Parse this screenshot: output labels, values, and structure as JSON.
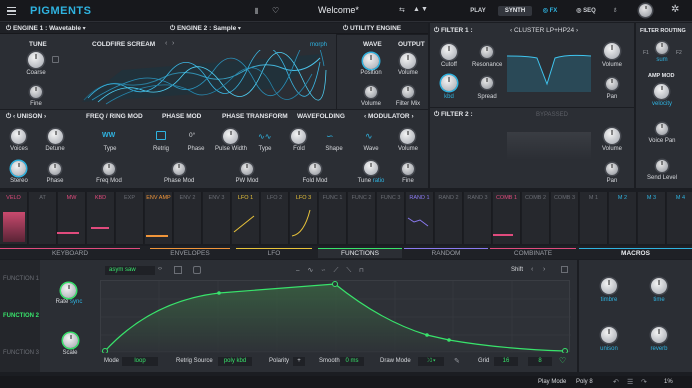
{
  "topbar": {
    "logo": "PIGMENTS",
    "preset": "Welcome*",
    "play": "PLAY",
    "synth": "SYNTH",
    "fx": "FX",
    "seq": "SEQ"
  },
  "engine1": {
    "title": "ENGINE 1 : Wavetable",
    "tune": "TUNE",
    "coarse": "Coarse",
    "fine": "Fine",
    "wavetable": "COLDFIRE SCREAM",
    "morph": "morph",
    "wave": "WAVE",
    "position": "Position",
    "output": "OUTPUT",
    "volume": "Volume",
    "volume2": "Volume",
    "filter_mix": "Filter Mix"
  },
  "engine2": {
    "title": "ENGINE 2 : Sample"
  },
  "utility": {
    "title": "UTILITY ENGINE"
  },
  "unison": {
    "title": "UNISON",
    "voices": "Voices",
    "detune": "Detune",
    "stereo": "Stereo",
    "phase": "Phase"
  },
  "freqring": {
    "title": "FREQ / RING MOD",
    "type": "Type",
    "freq_mod": "Freq Mod"
  },
  "phasemod": {
    "title": "PHASE MOD",
    "retrig": "Retrig",
    "phase": "Phase",
    "phase_val": "0°",
    "phase_mod": "Phase Mod"
  },
  "phasetransform": {
    "title": "PHASE TRANSFORM",
    "pulse_width": "Pulse Width",
    "type": "Type",
    "pw_mod": "PW Mod"
  },
  "wavefolding": {
    "title": "WAVEFOLDING",
    "fold": "Fold",
    "shape": "Shape",
    "fold_mod": "Fold Mod"
  },
  "modulator": {
    "title": "MODULATOR",
    "wave": "Wave",
    "volume": "Volume",
    "tune": "Tune",
    "ratio": "ratio",
    "fine": "Fine"
  },
  "filter1": {
    "title": "FILTER 1 :",
    "type": "CLUSTER LP+HP24",
    "cutoff": "Cutoff",
    "resonance": "Resonance",
    "kbd": "kbd",
    "spread": "Spread",
    "volume": "Volume",
    "pan": "Pan"
  },
  "filter2": {
    "title": "FILTER 2 :",
    "bypassed": "BYPASSED",
    "volume": "Volume",
    "pan": "Pan"
  },
  "routing": {
    "title": "FILTER ROUTING",
    "mode": "sum",
    "f1": "F1",
    "f2": "F2",
    "amp": "AMP MOD",
    "velocity": "velocity",
    "voice_pan": "Voice Pan",
    "send_level": "Send Level"
  },
  "mod_sources": [
    "VELO",
    "AT",
    "MW",
    "KBD",
    "EXP",
    "ENV AMP",
    "ENV 2",
    "ENV 3",
    "LFO 1",
    "LFO 2",
    "LFO 3",
    "FUNC 1",
    "FUNC 2",
    "FUNC 3",
    "RAND 1",
    "RAND 2",
    "RAND 3",
    "COMB 1",
    "COMB 2",
    "COMB 3",
    "M 1",
    "M 2",
    "M 3",
    "M 4"
  ],
  "tabs": [
    "KEYBOARD",
    "ENVELOPES",
    "LFO",
    "FUNCTIONS",
    "RANDOM",
    "COMBINATE",
    "MACROS"
  ],
  "functions": {
    "f1": "FUNCTION 1",
    "f2": "FUNCTION 2",
    "f3": "FUNCTION 3",
    "preset": "asym saw",
    "rate": "Rate",
    "sync": "sync",
    "scale": "Scale",
    "shift": "Shift",
    "mode": "Mode",
    "mode_val": "loop",
    "retrig": "Retrig Source",
    "retrig_val": "poly kbd",
    "polarity": "Polarity",
    "smooth": "Smooth",
    "smooth_val": "0 ms",
    "draw": "Draw Mode",
    "grid": "Grid",
    "grid_x": "16",
    "grid_y": "8"
  },
  "macros": {
    "m1": "timbre",
    "m2": "time",
    "m3": "unison",
    "m4": "reverb"
  },
  "status": {
    "play_mode": "Play Mode",
    "poly": "Poly 8",
    "cpu": "1%"
  }
}
